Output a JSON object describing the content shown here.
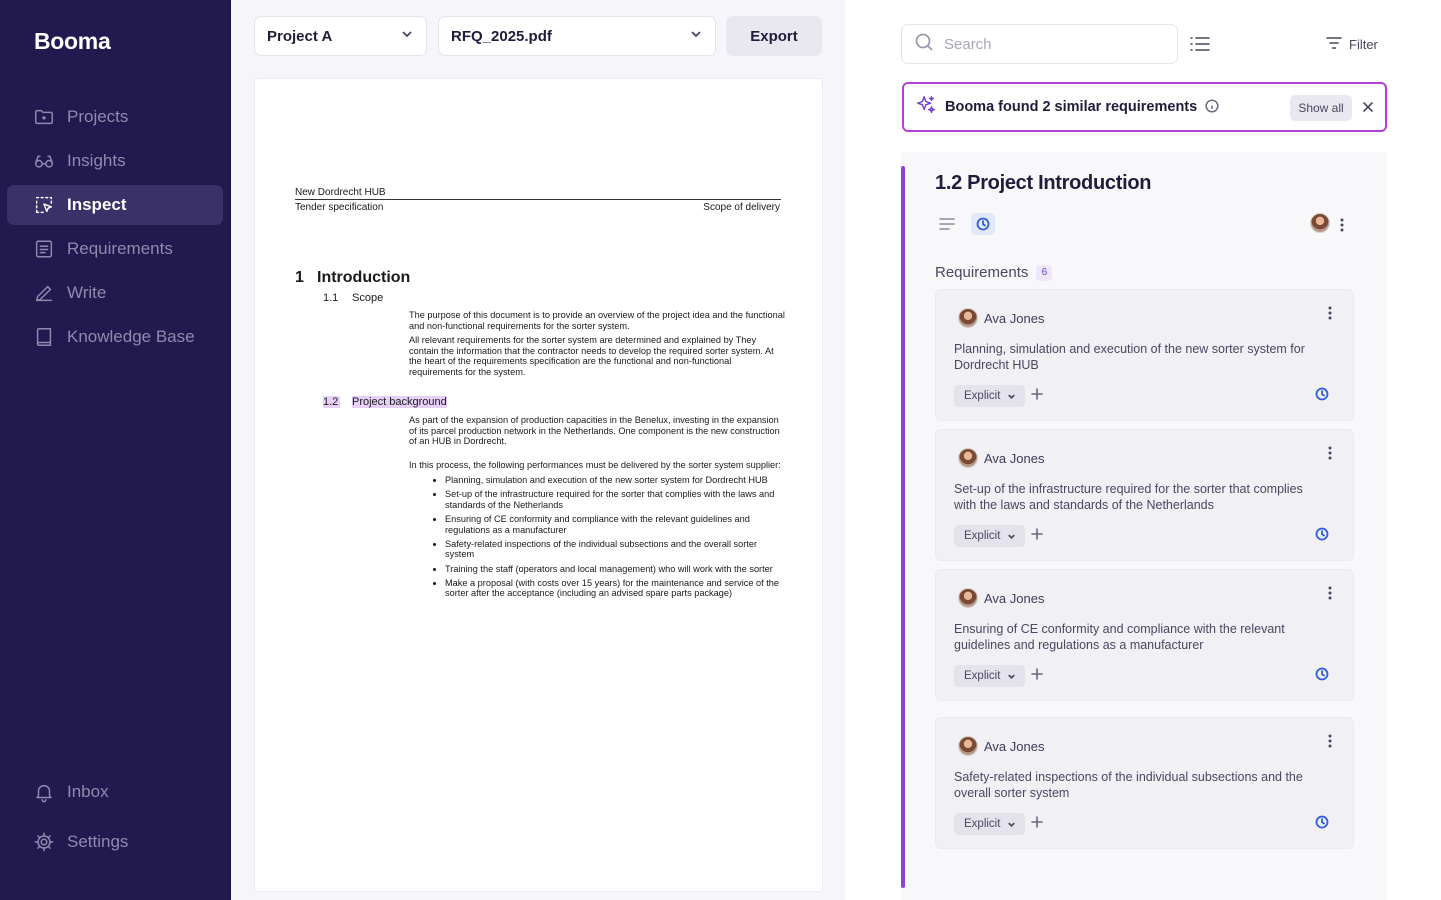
{
  "app": {
    "brand": "Booma"
  },
  "sidebar": {
    "items": [
      {
        "label": "Projects",
        "icon": "folder-icon"
      },
      {
        "label": "Insights",
        "icon": "glasses-icon"
      },
      {
        "label": "Inspect",
        "icon": "select-cursor-icon",
        "active": true
      },
      {
        "label": "Requirements",
        "icon": "document-list-icon"
      },
      {
        "label": "Write",
        "icon": "pencil-icon"
      },
      {
        "label": "Knowledge Base",
        "icon": "book-icon"
      }
    ],
    "bottom": [
      {
        "label": "Inbox",
        "icon": "bell-icon"
      },
      {
        "label": "Settings",
        "icon": "gear-icon"
      }
    ]
  },
  "toolbar": {
    "project_select": "Project A",
    "file_select": "RFQ_2025.pdf",
    "export_label": "Export"
  },
  "document": {
    "header_left_top": "New Dordrecht HUB",
    "header_left_bottom": "Tender specification",
    "header_right": "Scope of delivery",
    "section_num": "1",
    "section_title": "Introduction",
    "sub1_num": "1.1",
    "sub1_title": "Scope",
    "sub1_para1": "The purpose of this document is to provide an overview of the project idea and the functional and non-functional requirements for the sorter system.",
    "sub1_para2": "All relevant requirements for the sorter system are determined and explained by They contain the information that the contractor needs to develop the required sorter system. At the heart of the requirements specification are the functional and non-functional requirements for the system.",
    "sub2_num": "1.2",
    "sub2_title": "Project background",
    "sub2_para1": "As part of the expansion of production capacities in the Benelux,          investing in the expansion of its parcel production network in the Netherlands. One component is the new construction of an HUB in Dordrecht.",
    "sub2_para2": "In this process, the following performances must be delivered by the sorter system supplier:",
    "bullets": [
      "Planning, simulation and execution of the new sorter system for Dordrecht HUB",
      "Set-up of the infrastructure required for the sorter that complies with the laws and standards of the Netherlands",
      "Ensuring of CE conformity and compliance with the relevant guidelines and regulations as a manufacturer",
      "Safety-related inspections of the individual subsections and the overall sorter system",
      "Training the staff (operators and local management) who will work with the sorter",
      "Make a proposal (with costs over 15 years) for the maintenance and service of the sorter after the acceptance (including an advised spare parts package)"
    ]
  },
  "right": {
    "search_placeholder": "Search",
    "filter_label": "Filter",
    "banner": {
      "text": "Booma found 2 similar requirements",
      "show_all": "Show all"
    },
    "section": {
      "title": "1.2 Project Introduction",
      "requirements_label": "Requirements",
      "requirements_count": "6"
    },
    "cards": [
      {
        "author": "Ava Jones",
        "text": "Planning, simulation and execution of the new sorter system for Dordrecht HUB",
        "tag": "Explicit"
      },
      {
        "author": "Ava Jones",
        "text": "Set-up of the infrastructure required for the sorter that complies with the laws and standards of the Netherlands",
        "tag": "Explicit"
      },
      {
        "author": "Ava Jones",
        "text": "Ensuring of CE conformity and compliance with the relevant guidelines and regulations as a manufacturer",
        "tag": "Explicit"
      },
      {
        "author": "Ava Jones",
        "text": "Safety-related inspections of the individual subsections and the overall sorter system",
        "tag": "Explicit"
      }
    ]
  },
  "colors": {
    "sidebar_bg": "#221a4e",
    "sidebar_active": "#3a3168",
    "accent_purple": "#8a45d8",
    "banner_border": "#b43fd6",
    "clock_blue": "#2f5ed6",
    "highlight": "#e6d0f7"
  }
}
